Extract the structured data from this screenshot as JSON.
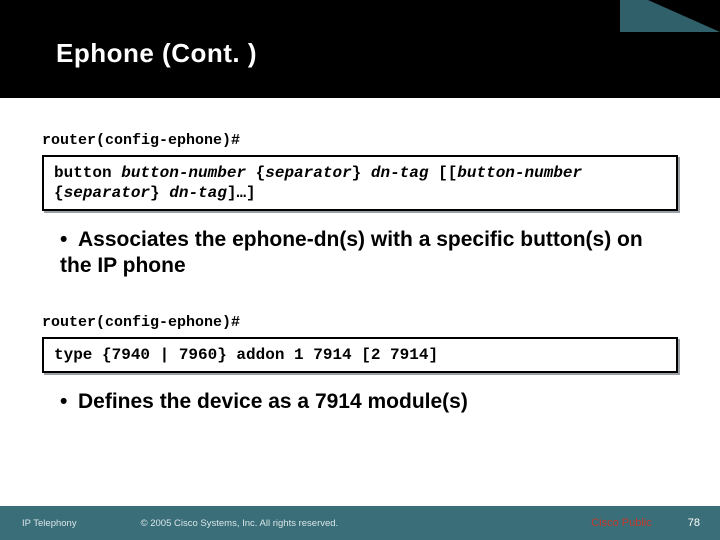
{
  "title": "Ephone (Cont. )",
  "block1": {
    "prompt": "router(config-ephone)#",
    "cmd_parts": {
      "kw1": "button ",
      "var1": "button-number",
      "txt1": " {",
      "var2": "separator",
      "txt2": "} ",
      "var3": "dn-tag",
      "txt3": " [[",
      "var4": "button-number",
      "txt4": " {",
      "var5": "separator",
      "txt5": "} ",
      "var6": "dn-tag",
      "txt6": "]…]"
    },
    "bullet": "Associates the ephone-dn(s) with a specific button(s) on the IP phone"
  },
  "block2": {
    "prompt": "router(config-ephone)#",
    "cmd": "type {7940 | 7960} addon 1 7914 [2 7914]",
    "bullet": "Defines the device as a 7914 module(s)"
  },
  "footer": {
    "left": "IP Telephony",
    "mid": "© 2005 Cisco Systems, Inc. All rights reserved.",
    "pub": "Cisco Public",
    "num": "78"
  }
}
